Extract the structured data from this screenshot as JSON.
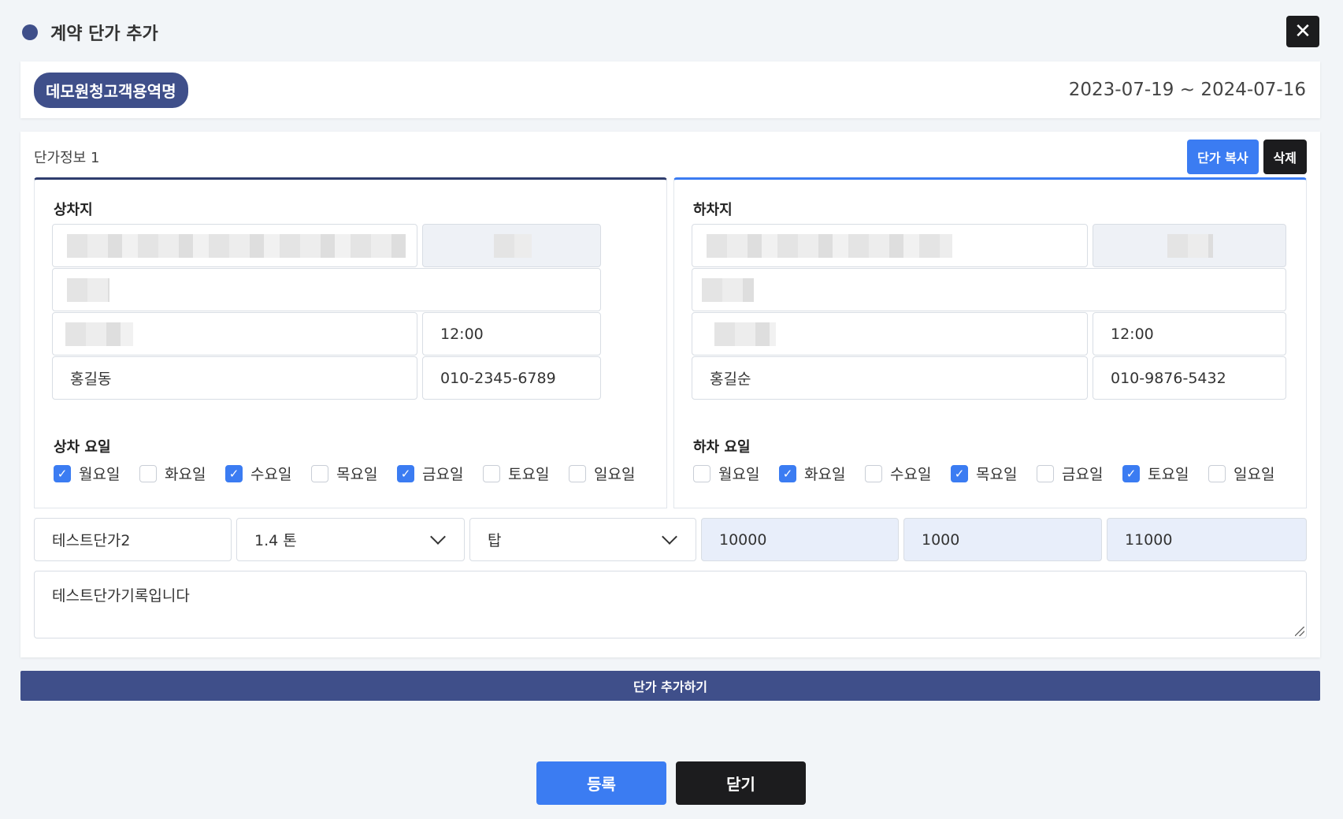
{
  "modal": {
    "title": "계약 단가 추가",
    "close_label": "✕"
  },
  "contract": {
    "customer_name": "데모원청고객용역명",
    "date_range": "2023-07-19 ~ 2024-07-16"
  },
  "price_info": {
    "title": "단가정보 1",
    "copy_label": "단가 복사",
    "delete_label": "삭제",
    "loading": {
      "label": "상차지",
      "time": "12:00",
      "contact_name": "홍길동",
      "contact_phone": "010-2345-6789",
      "days_label": "상차 요일",
      "days": [
        {
          "label": "월요일",
          "checked": true
        },
        {
          "label": "화요일",
          "checked": false
        },
        {
          "label": "수요일",
          "checked": true
        },
        {
          "label": "목요일",
          "checked": false
        },
        {
          "label": "금요일",
          "checked": true
        },
        {
          "label": "토요일",
          "checked": false
        },
        {
          "label": "일요일",
          "checked": false
        }
      ]
    },
    "unloading": {
      "label": "하차지",
      "time": "12:00",
      "contact_name": "홍길순",
      "contact_phone": "010-9876-5432",
      "days_label": "하차 요일",
      "days": [
        {
          "label": "월요일",
          "checked": false
        },
        {
          "label": "화요일",
          "checked": true
        },
        {
          "label": "수요일",
          "checked": false
        },
        {
          "label": "목요일",
          "checked": true
        },
        {
          "label": "금요일",
          "checked": false
        },
        {
          "label": "토요일",
          "checked": true
        },
        {
          "label": "일요일",
          "checked": false
        }
      ]
    },
    "price_name": "테스트단가2",
    "tonnage": "1.4 톤",
    "vehicle_type": "탑",
    "price_base": "10000",
    "price_tax": "1000",
    "price_total": "11000",
    "memo": "테스트단가기록입니다"
  },
  "actions": {
    "add_price_label": "단가 추가하기",
    "register_label": "등록",
    "close_label": "닫기"
  },
  "colors": {
    "navy": "#3f4f8a",
    "blue": "#3b7cf2",
    "dark": "#1c1c1e"
  }
}
